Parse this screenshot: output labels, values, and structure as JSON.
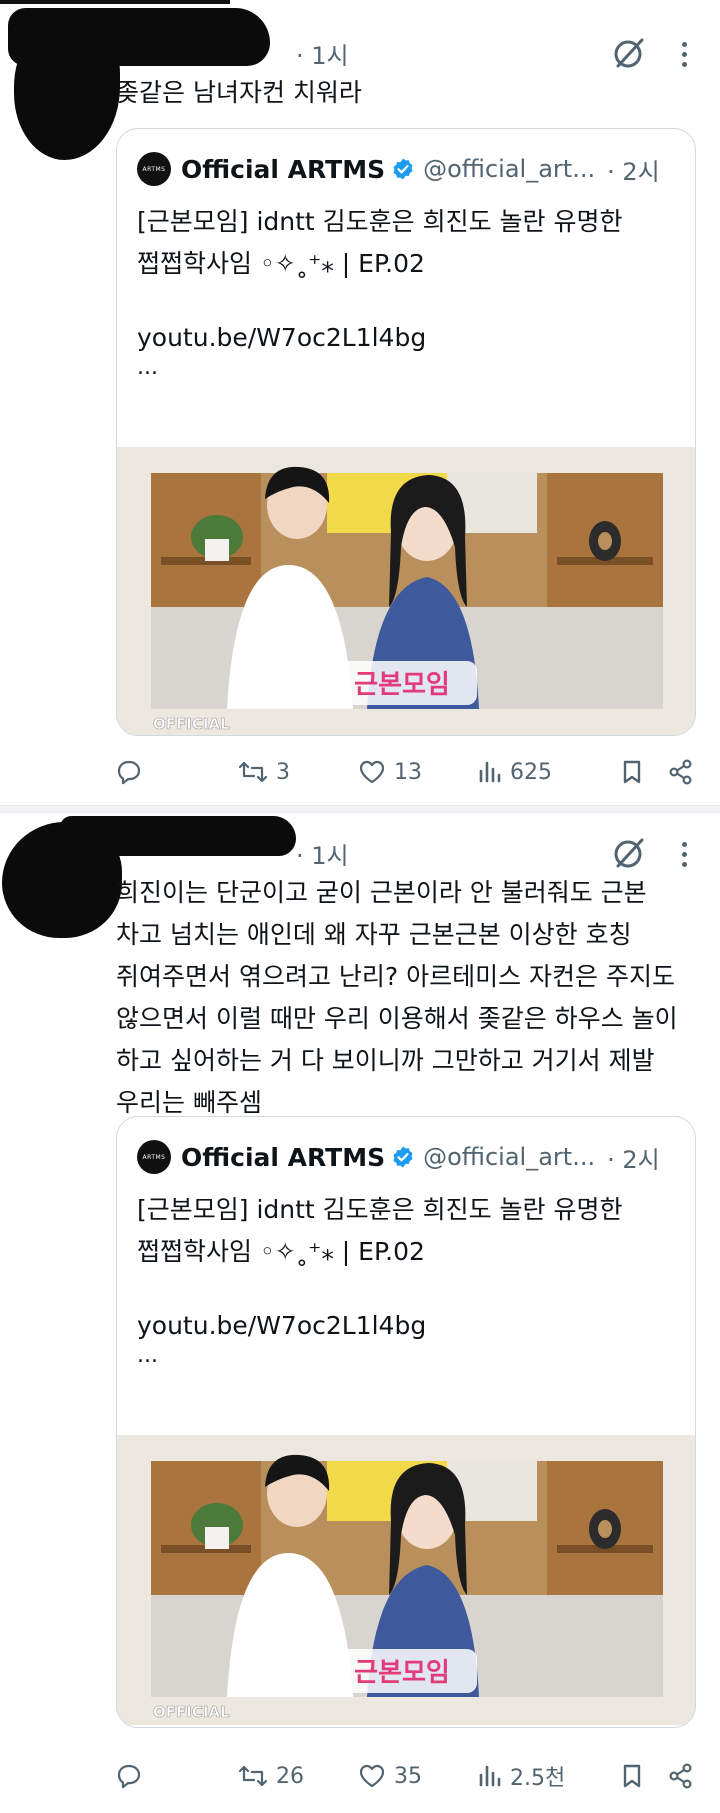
{
  "posts": [
    {
      "time": "· 1시",
      "text_lines": [
        "좆같은 남녀자컨 치워라"
      ],
      "quote": {
        "avatar_text": "ARTMS",
        "name": "Official ARTMS",
        "handle": "@official_art...",
        "time": "· 2시",
        "text_lines": [
          "[근본모임] idntt 김도훈은 희진도 놀란 유명한",
          "쩝쩝학사임 ◦✧˳⁺⁎ | EP.02"
        ],
        "link": "youtu.be/W7oc2L1l4bg",
        "ellipsis": "...",
        "thumb_title": "근본모임",
        "thumb_watermark": "OFFICIAL"
      },
      "stats": {
        "replies": "",
        "reposts": "3",
        "likes": "13",
        "views": "625"
      }
    },
    {
      "time": "· 1시",
      "text_lines": [
        "희진이는 단군이고 굳이 근본이라 안 불러줘도 근본",
        "차고 넘치는 애인데 왜 자꾸 근본근본 이상한 호칭",
        "쥐여주면서 엮으려고 난리? 아르테미스 자컨은 주지도",
        "않으면서 이럴 때만 우리 이용해서 좆같은 하우스 놀이",
        "하고 싶어하는 거 다 보이니까 그만하고 거기서 제발",
        "우리는 빼주셈"
      ],
      "quote": {
        "avatar_text": "ARTMS",
        "name": "Official ARTMS",
        "handle": "@official_art...",
        "time": "· 2시",
        "text_lines": [
          "[근본모임] idntt 김도훈은 희진도 놀란 유명한",
          "쩝쩝학사임 ◦✧˳⁺⁎ | EP.02"
        ],
        "link": "youtu.be/W7oc2L1l4bg",
        "ellipsis": "...",
        "thumb_title": "근본모임",
        "thumb_watermark": "OFFICIAL"
      },
      "stats": {
        "replies": "",
        "reposts": "26",
        "likes": "35",
        "views": "2.5천"
      }
    }
  ],
  "icons": [
    "grok-icon",
    "more-icon",
    "reply-icon",
    "repost-icon",
    "like-icon",
    "views-icon",
    "bookmark-icon",
    "share-icon",
    "verified-icon"
  ],
  "colors": {
    "text": "#0f1419",
    "muted": "#536471",
    "verified": "#1d9bf0",
    "border": "#cfd9de"
  }
}
